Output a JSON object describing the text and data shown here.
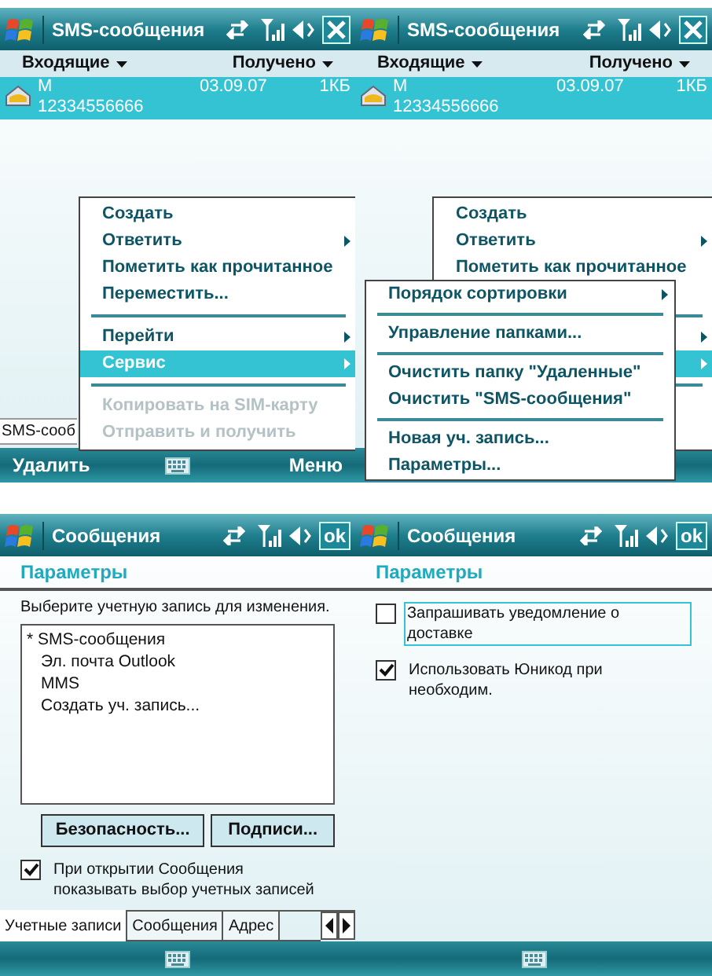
{
  "screens": [
    {
      "kind": "message_list",
      "title": "SMS-сообщения",
      "title_button": {
        "kind": "close"
      },
      "folder": "Входящие",
      "sort": "Получено",
      "messages": [
        {
          "sender": "M",
          "number": "12334556666",
          "date": "03.09.07",
          "size": "1КБ",
          "selected": true
        }
      ],
      "status_text": "SMS-сооб",
      "softkeys": [
        "Удалить",
        "Меню"
      ],
      "menus": [
        {
          "items": [
            {
              "kind": "item",
              "label": "Создать",
              "has_submenu": false,
              "disabled": false,
              "selected": false
            },
            {
              "kind": "item",
              "label": "Ответить",
              "has_submenu": true,
              "disabled": false,
              "selected": false
            },
            {
              "kind": "item",
              "label": "Пометить как прочитанное",
              "has_submenu": false,
              "disabled": false,
              "selected": false
            },
            {
              "kind": "item",
              "label": "Переместить...",
              "has_submenu": false,
              "disabled": false,
              "selected": false
            },
            {
              "kind": "separator"
            },
            {
              "kind": "item",
              "label": "Перейти",
              "has_submenu": true,
              "disabled": false,
              "selected": false
            },
            {
              "kind": "item",
              "label": "Сервис",
              "has_submenu": true,
              "disabled": false,
              "selected": true
            },
            {
              "kind": "separator"
            },
            {
              "kind": "item",
              "label": "Копировать на SIM-карту",
              "has_submenu": false,
              "disabled": true,
              "selected": false
            },
            {
              "kind": "item",
              "label": "Отправить и получить",
              "has_submenu": false,
              "disabled": true,
              "selected": false
            }
          ]
        }
      ]
    },
    {
      "kind": "message_list",
      "title": "SMS-сообщения",
      "title_button": {
        "kind": "close"
      },
      "folder": "Входящие",
      "sort": "Получено",
      "messages": [
        {
          "sender": "M",
          "number": "12334556666",
          "date": "03.09.07",
          "size": "1КБ",
          "selected": true
        }
      ],
      "menus": [
        {
          "items": [
            {
              "kind": "item",
              "label": "Создать",
              "has_submenu": false,
              "disabled": false,
              "selected": false
            },
            {
              "kind": "item",
              "label": "Ответить",
              "has_submenu": true,
              "disabled": false,
              "selected": false
            },
            {
              "kind": "item",
              "label": "Пометить как прочитанное",
              "has_submenu": false,
              "disabled": false,
              "selected": false
            },
            {
              "kind": "item",
              "has_submenu": false,
              "selected": false
            },
            {
              "kind": "separator"
            },
            {
              "kind": "item",
              "has_submenu": true,
              "selected": false
            },
            {
              "kind": "item",
              "has_submenu": true,
              "selected": true
            },
            {
              "kind": "separator"
            },
            {
              "kind": "item",
              "has_submenu": false,
              "selected": false
            },
            {
              "kind": "item",
              "has_submenu": false,
              "selected": false
            }
          ]
        },
        {
          "kind": "submenu",
          "items": [
            {
              "kind": "item",
              "label": "Порядок сортировки",
              "has_submenu": true,
              "disabled": false,
              "selected": false
            },
            {
              "kind": "separator"
            },
            {
              "kind": "item",
              "label": "Управление папками...",
              "has_submenu": false,
              "disabled": false,
              "selected": false
            },
            {
              "kind": "separator"
            },
            {
              "kind": "item",
              "label": "Очистить папку \"Удаленные\"",
              "has_submenu": false,
              "disabled": false,
              "selected": false
            },
            {
              "kind": "item",
              "label": "Очистить \"SMS-сообщения\"",
              "has_submenu": false,
              "disabled": false,
              "selected": false
            },
            {
              "kind": "separator"
            },
            {
              "kind": "item",
              "label": "Новая уч. запись...",
              "has_submenu": false,
              "disabled": false,
              "selected": false
            },
            {
              "kind": "item",
              "label": "Параметры...",
              "has_submenu": false,
              "disabled": false,
              "selected": false
            }
          ]
        }
      ]
    },
    {
      "kind": "accounts",
      "title": "Сообщения",
      "title_button": {
        "kind": "ok",
        "label": "ok"
      },
      "heading": "Параметры",
      "prompt": "Выберите учетную запись для изменения.",
      "accounts": [
        {
          "label": "* SMS-сообщения"
        },
        {
          "label": "Эл. почта Outlook"
        },
        {
          "label": "MMS"
        },
        {
          "label": "Создать уч. запись..."
        }
      ],
      "buttons": [
        "Безопасность...",
        "Подписи..."
      ],
      "checkboxes": [
        {
          "label": "При открытии Сообщения показывать выбор учетных записей",
          "checked": true,
          "focused": false
        }
      ],
      "tabs": [
        {
          "label": "Учетные записи",
          "selected": true
        },
        {
          "label": "Сообщения",
          "selected": false
        },
        {
          "label": "Адрес",
          "selected": false
        }
      ]
    },
    {
      "kind": "options",
      "title": "Сообщения",
      "title_button": {
        "kind": "ok",
        "label": "ok"
      },
      "heading": "Параметры",
      "checkboxes": [
        {
          "label": "Запрашивать уведомление о доставке",
          "checked": false,
          "focused": true
        },
        {
          "label": "Использовать Юникод при необходим.",
          "checked": true,
          "focused": false
        }
      ]
    }
  ]
}
